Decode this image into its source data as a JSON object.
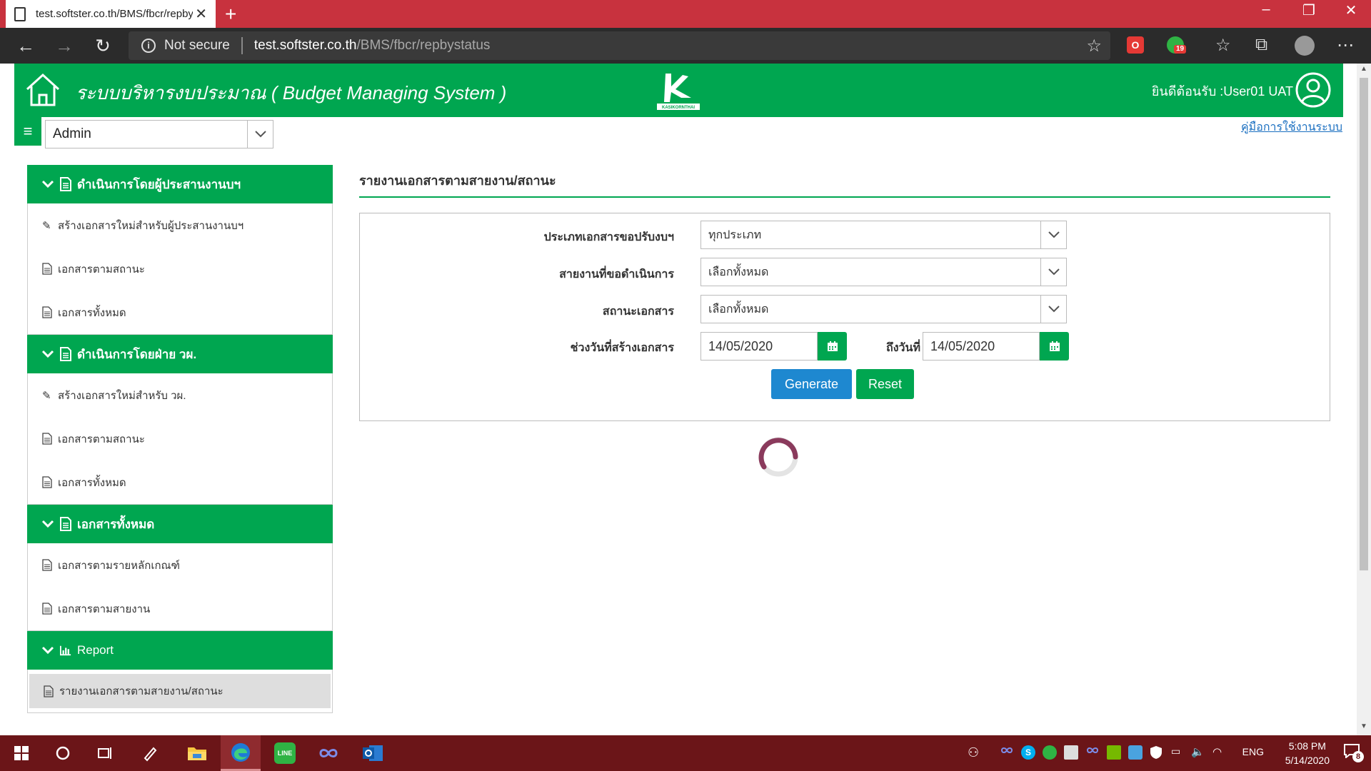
{
  "browser": {
    "tab_title": "test.softster.co.th/BMS/fbcr/repbystatus",
    "security_label": "Not secure",
    "url_host": "test.softster.co.th",
    "url_path": "/BMS/fbcr/repbystatus",
    "ext_badge": "19"
  },
  "header": {
    "title": "ระบบบริหารงบประมาณ ( Budget Managing System )",
    "logo_text": "KASIKORNTHAI",
    "welcome": "ยินดีต้อนรับ :User01 UAT"
  },
  "topbar": {
    "role_value": "Admin",
    "manual_link": "คู่มือการใช้งานระบบ"
  },
  "sidebar": {
    "sections": [
      {
        "title": "ดำเนินการโดยผู้ประสานงานบฯ",
        "items": [
          "สร้างเอกสารใหม่สำหรับผู้ประสานงานบฯ",
          "เอกสารตามสถานะ",
          "เอกสารทั้งหมด"
        ]
      },
      {
        "title": "ดำเนินการโดยฝ่าย วผ.",
        "items": [
          "สร้างเอกสารใหม่สำหรับ วผ.",
          "เอกสารตามสถานะ",
          "เอกสารทั้งหมด"
        ]
      },
      {
        "title": "เอกสารทั้งหมด",
        "items": [
          "เอกสารตามรายหลักเกณฑ์",
          "เอกสารตามสายงาน"
        ]
      },
      {
        "title": "Report",
        "items": [
          "รายงานเอกสารตามสายงาน/สถานะ"
        ]
      }
    ]
  },
  "main": {
    "title": "รายงานเอกสารตามสายงาน/สถานะ",
    "form": {
      "doc_type_label": "ประเภทเอกสารขอปรับงบฯ",
      "doc_type_value": "ทุกประเภท",
      "division_label": "สายงานที่ขอดำเนินการ",
      "division_value": "เลือกทั้งหมด",
      "status_label": "สถานะเอกสาร",
      "status_value": "เลือกทั้งหมด",
      "date_range_label": "ช่วงวันที่สร้างเอกสาร",
      "date_from": "14/05/2020",
      "date_to_label": "ถึงวันที่",
      "date_to": "14/05/2020",
      "generate_label": "Generate",
      "reset_label": "Reset"
    }
  },
  "taskbar": {
    "lang": "ENG",
    "time": "5:08 PM",
    "date": "5/14/2020",
    "notification_count": "8"
  },
  "colors": {
    "brand_green": "#00a650",
    "primary_blue": "#1e88d0",
    "titlebar_red": "#c8323e",
    "taskbar": "#6b1518",
    "spinner": "#8a3a5c"
  }
}
